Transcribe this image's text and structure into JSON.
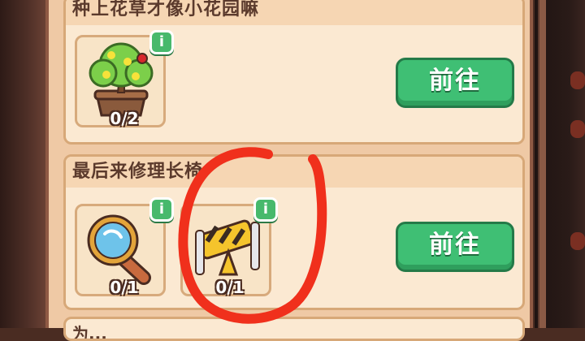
{
  "quests": [
    {
      "title": "种上花草才像小花园嘛",
      "items": [
        {
          "icon": "potted-tree-icon",
          "count": "0/2"
        }
      ],
      "button_label": "前往"
    },
    {
      "title": "最后来修理长椅",
      "items": [
        {
          "icon": "magnifying-glass-icon",
          "count": "0/1"
        },
        {
          "icon": "repair-kit-icon",
          "count": "0/1"
        }
      ],
      "button_label": "前往"
    }
  ],
  "partial_next_title": "为...",
  "info_label": "i",
  "colors": {
    "panel": "#efc9a5",
    "card": "#fbe9d2",
    "button": "#3fbf74",
    "annotation": "#f0301c"
  }
}
